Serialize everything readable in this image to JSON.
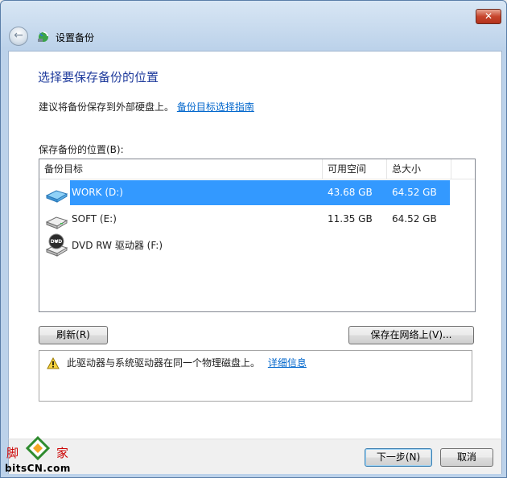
{
  "window": {
    "title": "设置备份",
    "close_glyph": "✕"
  },
  "page": {
    "heading": "选择要保存备份的位置",
    "advice_text": "建议将备份保存到外部硬盘上。",
    "advice_link": "备份目标选择指南",
    "location_label": "保存备份的位置(B):"
  },
  "table": {
    "columns": [
      "备份目标",
      "可用空间",
      "总大小"
    ],
    "rows": [
      {
        "name": "WORK (D:)",
        "free": "43.68 GB",
        "total": "64.52 GB",
        "icon": "hard-drive-icon",
        "selected": true
      },
      {
        "name": "SOFT (E:)",
        "free": "11.35 GB",
        "total": "64.52 GB",
        "icon": "hard-drive-icon",
        "selected": false
      },
      {
        "name": "DVD RW 驱动器 (F:)",
        "free": "",
        "total": "",
        "icon": "dvd-drive-icon",
        "selected": false
      }
    ]
  },
  "buttons": {
    "refresh": "刷新(R)",
    "save_network": "保存在网络上(V)...",
    "next": "下一步(N)",
    "cancel": "取消"
  },
  "warning": {
    "text": "此驱动器与系统驱动器在同一个物理磁盘上。",
    "link": "详细信息"
  },
  "watermark": {
    "text_left": "脚",
    "text_right": "家",
    "site": "bitsCN.com"
  },
  "colors": {
    "selection": "#3399ff",
    "heading": "#1f3b9c",
    "link": "#0066cc"
  }
}
